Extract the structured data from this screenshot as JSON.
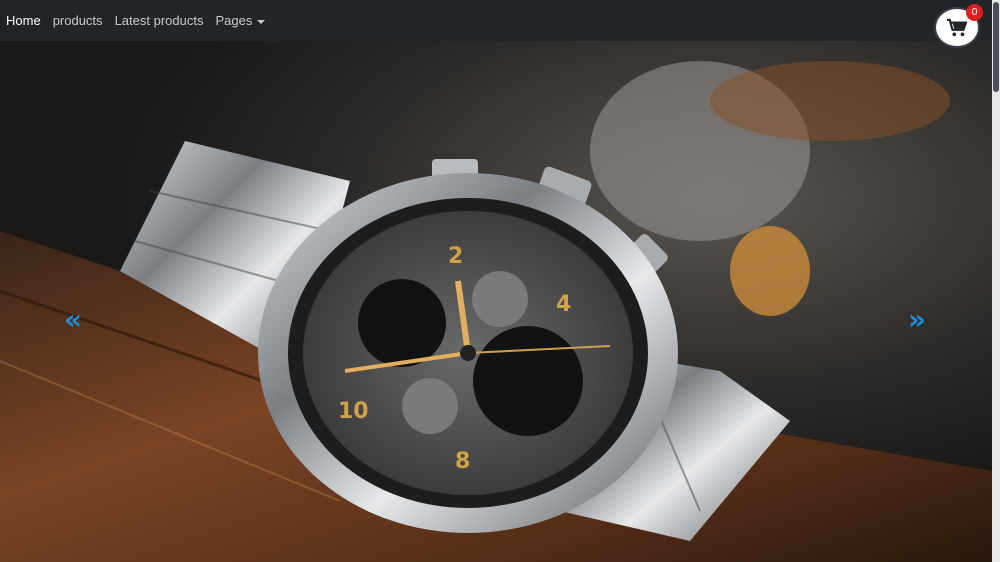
{
  "navbar": {
    "links": [
      {
        "label": "Home"
      },
      {
        "label": "products"
      },
      {
        "label": "Latest products"
      },
      {
        "label": "Pages"
      }
    ]
  },
  "cart": {
    "count": "0"
  },
  "carousel": {
    "prev_label": "«",
    "next_label": "»",
    "slide_subject": "chronograph wristwatch"
  },
  "colors": {
    "navbar_bg": "#212529",
    "accent_arrow": "#1a8fd6",
    "badge": "#dc1f1f"
  }
}
